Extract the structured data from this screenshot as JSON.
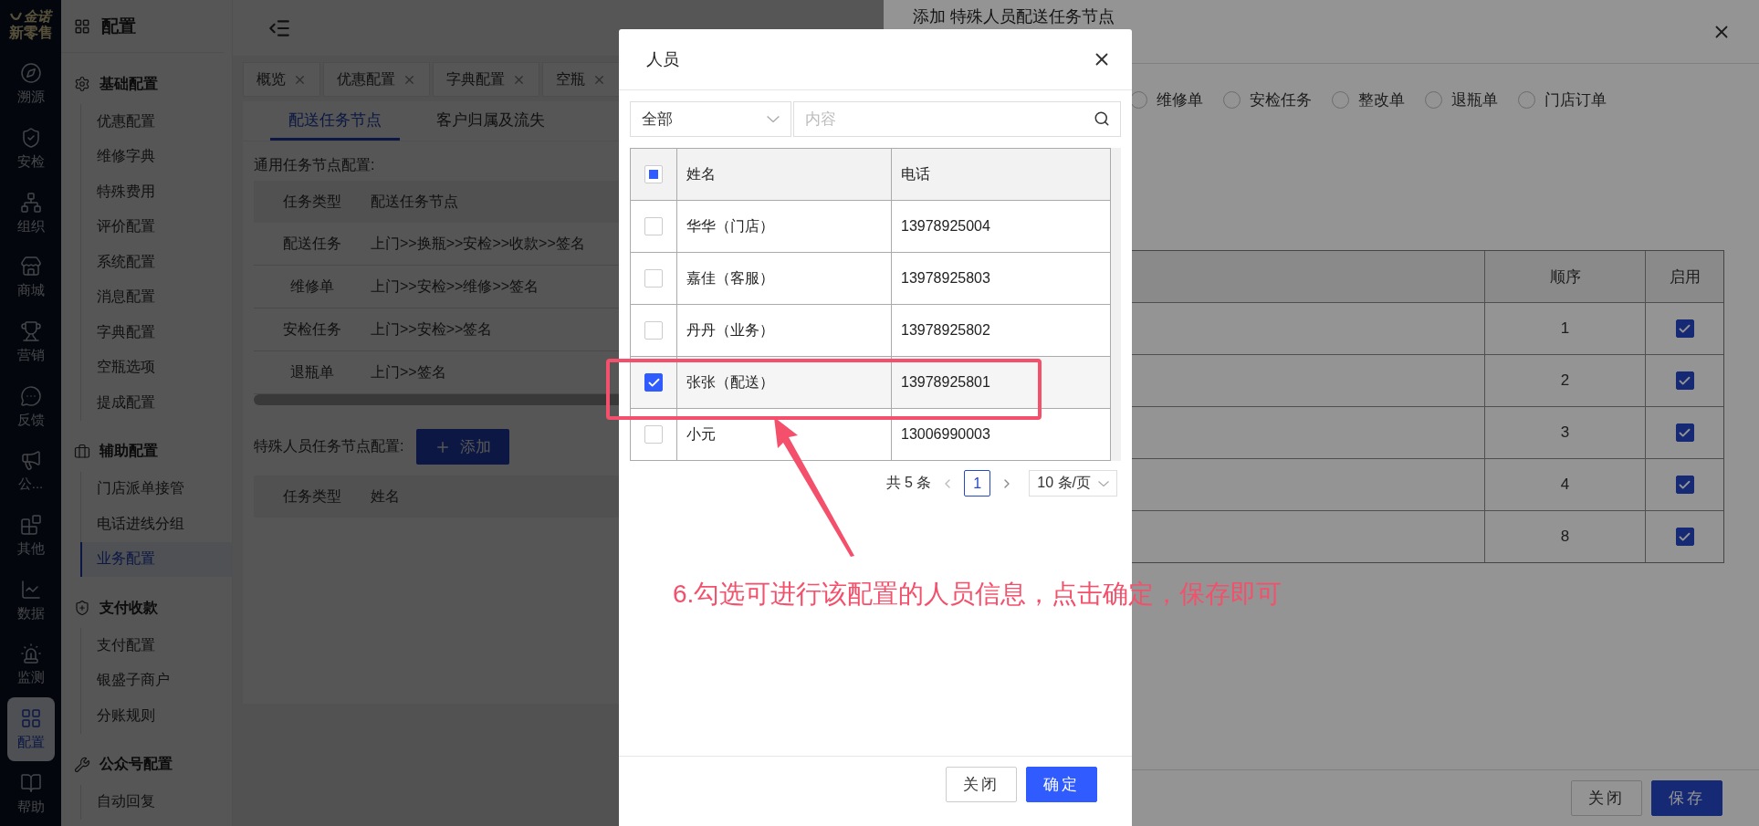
{
  "rail": {
    "logo": "金诺",
    "brand": "新零售",
    "items": [
      {
        "label": "溯源",
        "selected": false
      },
      {
        "label": "安检",
        "selected": false
      },
      {
        "label": "组织",
        "selected": false
      },
      {
        "label": "商城",
        "selected": false
      },
      {
        "label": "营销",
        "selected": false
      },
      {
        "label": "反馈",
        "selected": false
      },
      {
        "label": "公...",
        "selected": false
      },
      {
        "label": "其他",
        "selected": false
      },
      {
        "label": "数据",
        "selected": false
      },
      {
        "label": "监测",
        "selected": false
      },
      {
        "label": "配置",
        "selected": true
      },
      {
        "label": "帮助",
        "selected": false
      }
    ]
  },
  "menu": {
    "title": "配置",
    "groups": [
      {
        "title": "基础配置",
        "items": [
          {
            "label": "优惠配置",
            "selected": false
          },
          {
            "label": "维修字典",
            "selected": false
          },
          {
            "label": "特殊费用",
            "selected": false
          },
          {
            "label": "评价配置",
            "selected": false
          },
          {
            "label": "系统配置",
            "selected": false
          },
          {
            "label": "消息配置",
            "selected": false
          },
          {
            "label": "字典配置",
            "selected": false
          },
          {
            "label": "空瓶选项",
            "selected": false
          },
          {
            "label": "提成配置",
            "selected": false
          }
        ]
      },
      {
        "title": "辅助配置",
        "items": [
          {
            "label": "门店派单接管",
            "selected": false
          },
          {
            "label": "电话进线分组",
            "selected": false
          },
          {
            "label": "业务配置",
            "selected": true
          }
        ]
      },
      {
        "title": "支付收款",
        "items": [
          {
            "label": "支付配置",
            "selected": false
          },
          {
            "label": "银盛子商户",
            "selected": false
          },
          {
            "label": "分账规则",
            "selected": false
          }
        ]
      },
      {
        "title": "公众号配置",
        "items": [
          {
            "label": "自动回复",
            "selected": false
          }
        ]
      }
    ]
  },
  "page_tabs": [
    {
      "label": "概览"
    },
    {
      "label": "优惠配置"
    },
    {
      "label": "字典配置"
    },
    {
      "label": "空瓶"
    }
  ],
  "sub_tabs": [
    {
      "label": "配送任务节点",
      "selected": true
    },
    {
      "label": "客户归属及流失",
      "selected": false
    }
  ],
  "general": {
    "title": "通用任务节点配置:",
    "header": [
      "任务类型",
      "配送任务节点"
    ],
    "rows": [
      [
        "配送任务",
        "上门>>换瓶>>安检>>收款>>签名"
      ],
      [
        "维修单",
        "上门>>安检>>维修>>签名"
      ],
      [
        "安检任务",
        "上门>>安检>>签名"
      ],
      [
        "退瓶单",
        "上门>>签名"
      ]
    ]
  },
  "special": {
    "title": "特殊人员任务节点配置:",
    "add_button": "添加",
    "columns": [
      "任务类型",
      "姓名"
    ]
  },
  "drawer": {
    "title": "添加 特殊人员配送任务节点",
    "task_types": [
      {
        "label": "维修单",
        "selected": false
      },
      {
        "label": "安检任务",
        "selected": false
      },
      {
        "label": "整改单",
        "selected": false
      },
      {
        "label": "退瓶单",
        "selected": false
      },
      {
        "label": "门店订单",
        "selected": false
      }
    ],
    "columns": [
      "顺序",
      "启用"
    ],
    "rows": [
      {
        "order": "1",
        "enabled": true
      },
      {
        "order": "2",
        "enabled": true
      },
      {
        "order": "3",
        "enabled": true
      },
      {
        "order": "4",
        "enabled": true
      },
      {
        "order": "8",
        "enabled": true
      }
    ],
    "close_button": "关闭",
    "save_button": "保存"
  },
  "modal": {
    "title": "人员",
    "filter": {
      "value": "全部"
    },
    "search": {
      "placeholder": "内容"
    },
    "header_checkbox": {
      "indeterminate": true
    },
    "columns": [
      "姓名",
      "电话"
    ],
    "rows": [
      {
        "name": "华华（门店）",
        "phone": "13978925004",
        "checked": false
      },
      {
        "name": "嘉佳（客服）",
        "phone": "13978925803",
        "checked": false
      },
      {
        "name": "丹丹（业务）",
        "phone": "13978925802",
        "checked": false
      },
      {
        "name": "张张（配送）",
        "phone": "13978925801",
        "checked": true
      },
      {
        "name": "小元",
        "phone": "13006990003",
        "checked": false
      }
    ],
    "pagination": {
      "total": "共 5 条",
      "pages": [
        {
          "label": "1",
          "selected": true
        }
      ],
      "page_size": "10 条/页"
    },
    "close_button": "关闭",
    "confirm_button": "确定"
  },
  "annotation": {
    "text": "6.勾选可进行该配置的人员信息，点击确定，保存即可"
  }
}
